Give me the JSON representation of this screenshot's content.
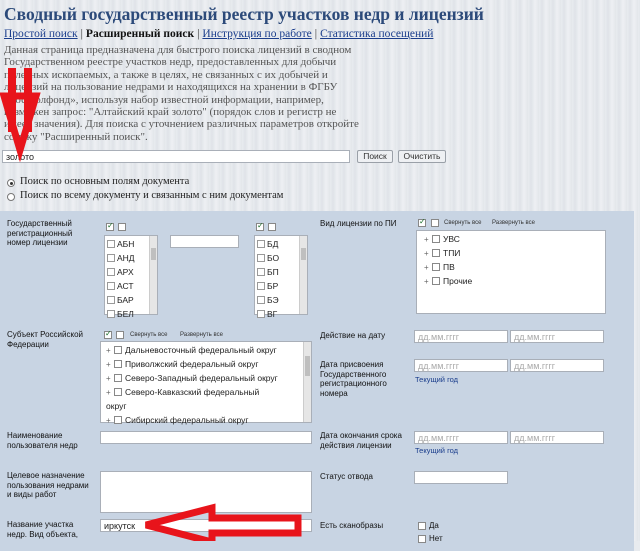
{
  "page_title": "Сводный государственный реестр участков недр и лицензий",
  "nav": {
    "simple_search": "Простой поиск",
    "advanced_search": "Расширенный поиск",
    "instructions": "Инструкция по работе",
    "statistics": "Статистика посещений",
    "sep": "|"
  },
  "description": "Данная страница предназначена для быстрого поиска лицензий в сводном Государственном реестре участков недр, предоставленных для добычи полезных ископаемых, а также в целях, не связанных с их добычей и лицензий на пользование недрами и находящихся на хранении в ФГБУ «Росгеолфонд», используя набор известной информации, например, возможен запрос: \"Алтайский край золото\" (порядок слов и регистр не имеет значения). Для поиска с уточнением различных параметров откройте ссылку \"Расширенный поиск\".",
  "search": {
    "value": "золото",
    "search_label": "Поиск",
    "clear_label": "Очистить"
  },
  "radios": {
    "main_fields": "Поиск по основным полям документа",
    "all_doc": "Поиск по всему документу и связанным с ним документам"
  },
  "form": {
    "reg_number_label": "Государственный регистрационный номер лицензии",
    "list1": [
      "АБН",
      "АНД",
      "АРХ",
      "АСТ",
      "БАР",
      "БЕЛ"
    ],
    "list2": [
      "БД",
      "БО",
      "БП",
      "БР",
      "БЭ",
      "ВГ"
    ],
    "license_type_label": "Вид лицензии по ПИ",
    "collapse_all": "Свернуть все",
    "expand_all": "Развернуть все",
    "license_types": [
      "УВС",
      "ТПИ",
      "ПВ",
      "Прочие"
    ],
    "subject_label": "Субъект Российской Федерации",
    "districts": [
      "Дальневосточный федеральный округ",
      "Приволжский федеральный округ",
      "Северо-Западный федеральный округ",
      "Северо-Кавказский федеральный",
      "округ",
      "Сибирский федеральный округ"
    ],
    "action_date_label": "Действие на дату",
    "date_placeholder": "дд.мм.гггг",
    "assign_date_label": "Дата присвоения Государственного регистрационного номера",
    "current_year": "Текущий год",
    "user_name_label": "Наименование пользователя недр",
    "end_date_label": "Дата окончания срока действия лицензии",
    "purpose_label": "Целевое назначение пользования недрами и виды работ",
    "status_label": "Статус отвода",
    "area_name_label": "Название участка недр. Вид объекта,",
    "area_name_value": "иркутск",
    "scans_label": "Есть сканобразы",
    "yes": "Да",
    "no": "Нет"
  },
  "annotation_color": "#e8141b"
}
